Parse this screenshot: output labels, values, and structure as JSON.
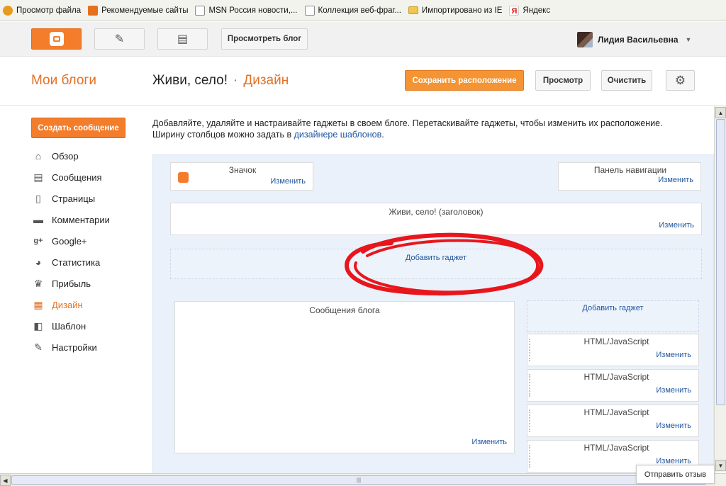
{
  "favorites": [
    {
      "label": "Просмотр файла",
      "icon": "ie-icon"
    },
    {
      "label": "Рекомендуемые сайты",
      "icon": "suggested-sites-icon"
    },
    {
      "label": "MSN Россия новости,...",
      "icon": "page-icon"
    },
    {
      "label": "Коллекция веб-фраг...",
      "icon": "page-icon"
    },
    {
      "label": "Импортировано из IE",
      "icon": "folder-icon"
    },
    {
      "label": "Яндекс",
      "icon": "yandex-icon"
    }
  ],
  "appbar": {
    "view_blog_label": "Просмотреть блог",
    "user_name": "Лидия Васильевна"
  },
  "header": {
    "my_blogs": "Мои блоги",
    "blog_name": "Живи, село!",
    "separator": "·",
    "section": "Дизайн",
    "save_label": "Сохранить расположение",
    "preview_label": "Просмотр",
    "clear_label": "Очистить"
  },
  "sidebar": {
    "create_label": "Создать сообщение",
    "items": [
      {
        "label": "Обзор",
        "icon": "home-icon"
      },
      {
        "label": "Сообщения",
        "icon": "posts-icon"
      },
      {
        "label": "Страницы",
        "icon": "pages-icon"
      },
      {
        "label": "Комментарии",
        "icon": "comments-icon"
      },
      {
        "label": "Google+",
        "icon": "google-plus-icon"
      },
      {
        "label": "Статистика",
        "icon": "stats-icon"
      },
      {
        "label": "Прибыль",
        "icon": "earnings-icon"
      },
      {
        "label": "Дизайн",
        "icon": "layout-icon",
        "active": true
      },
      {
        "label": "Шаблон",
        "icon": "template-icon"
      },
      {
        "label": "Настройки",
        "icon": "settings-icon"
      }
    ]
  },
  "content": {
    "desc_line1": "Добавляйте, удаляйте и настраивайте гаджеты в своем блоге. Перетаскивайте гаджеты, чтобы изменить их расположение.",
    "desc_line2_prefix": "Ширину столбцов можно задать в ",
    "desc_link": "дизайнере шаблонов",
    "desc_line2_suffix": "."
  },
  "layout": {
    "favicon_title": "Значок",
    "navbar_title": "Панель навигации",
    "header_title": "Живи, село! (заголовок)",
    "add_gadget": "Добавить гаджет",
    "posts_title": "Сообщения блога",
    "edit": "Изменить",
    "sidebar_gadgets": [
      "HTML/JavaScript",
      "HTML/JavaScript",
      "HTML/JavaScript",
      "HTML/JavaScript"
    ]
  },
  "feedback_label": "Отправить отзыв",
  "colors": {
    "accent": "#f37d2b",
    "link": "#2256a0",
    "highlight_circle": "#e8161c"
  }
}
